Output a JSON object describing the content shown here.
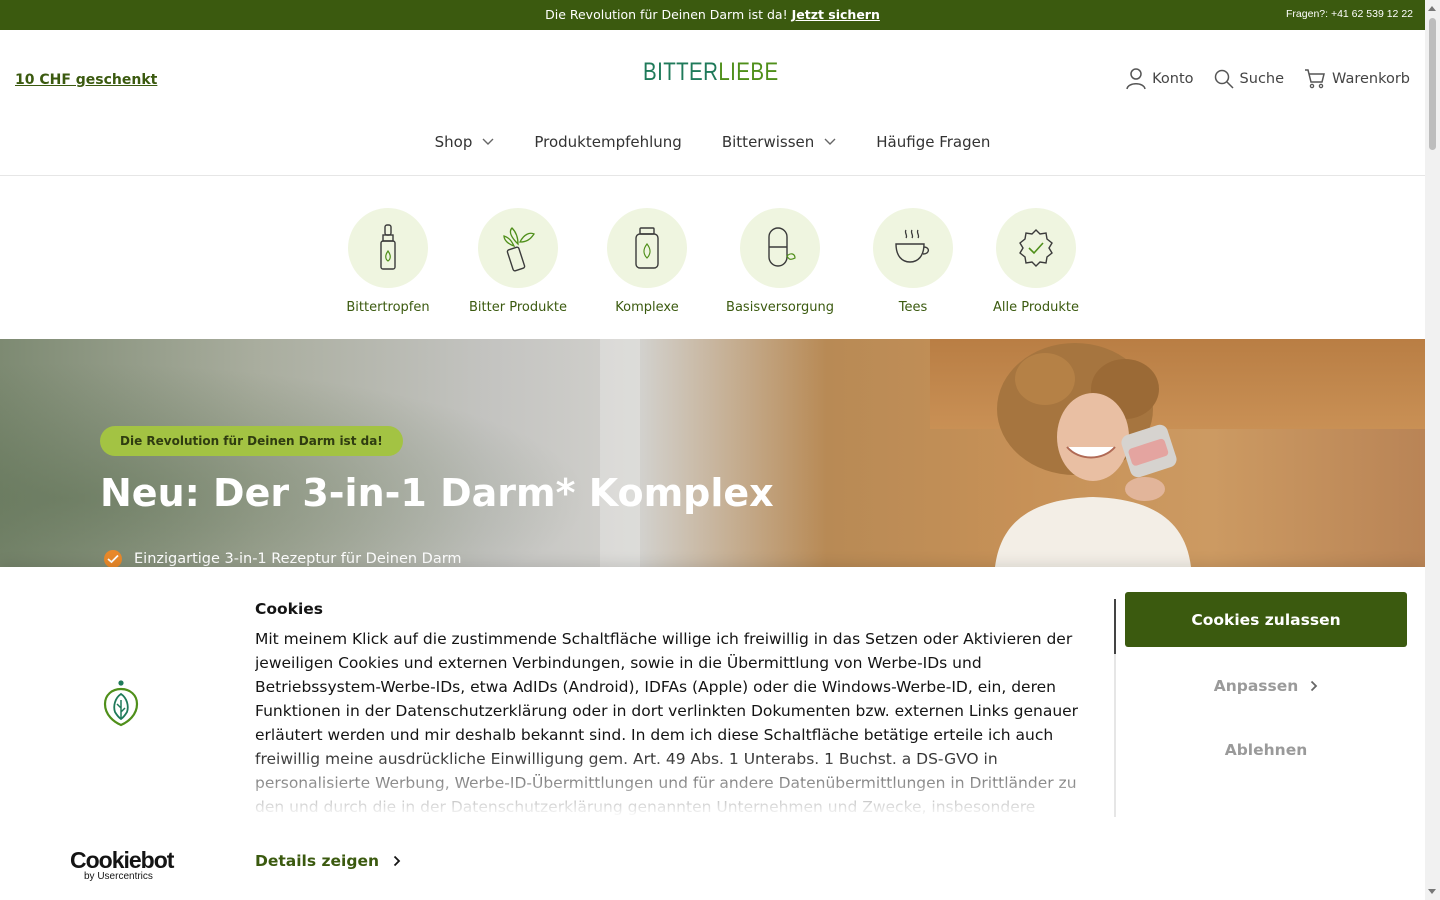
{
  "announcement": {
    "text": "Die Revolution für Deinen Darm ist da!",
    "link": "Jetzt sichern",
    "phone": "Fragen?: +41 62 539 12 22"
  },
  "header": {
    "gift_link": "10 CHF geschenkt",
    "logo": {
      "part1": "BITTER",
      "part2": "LIEBE"
    },
    "utils": {
      "account": "Konto",
      "search": "Suche",
      "cart": "Warenkorb"
    },
    "nav": [
      "Shop",
      "Produktempfehlung",
      "Bitterwissen",
      "Häufige Fragen"
    ]
  },
  "categories": [
    {
      "label": "Bittertropfen",
      "icon": "dropper-bottle-icon"
    },
    {
      "label": "Bitter Produkte",
      "icon": "herb-spray-icon"
    },
    {
      "label": "Komplexe",
      "icon": "supplement-jar-icon"
    },
    {
      "label": "Basisversorgung",
      "icon": "capsule-icon"
    },
    {
      "label": "Tees",
      "icon": "tea-cup-icon"
    },
    {
      "label": "Alle Produkte",
      "icon": "badge-check-icon"
    }
  ],
  "hero": {
    "badge": "Die Revolution für Deinen Darm ist da!",
    "title": "Neu: Der 3-in-1 Darm* Komplex",
    "bullet": "Einzigartige 3-in-1 Rezeptur für Deinen Darm"
  },
  "cookie": {
    "title": "Cookies",
    "body": "Mit meinem Klick auf die zustimmende Schaltfläche willige ich freiwillig in das Setzen oder Aktivieren der jeweiligen Cookies und externen Verbindungen, sowie in die Übermittlung von Werbe-IDs und Betriebssystem-Werbe-IDs, etwa AdIDs (Android), IDFAs (Apple) oder die Windows-Werbe-ID, ein, deren Funktionen in der Datenschutzerklärung oder in dort verlinkten Dokumenten bzw. externen Links genauer erläutert werden und mir deshalb bekannt sind. In dem ich diese Schaltfläche betätige erteile ich auch freiwillig meine ausdrückliche Einwilligung gem. Art. 49 Abs. 1 Unterabs. 1 Buchst. a DS-GVO in personalisierte Werbung, Werbe-ID-Übermittlungen und für andere Datenübermittlungen in Drittländer zu den und durch die in der Datenschutzerklärung genannten Unternehmen und Zwecke, insbesondere",
    "details": "Details zeigen",
    "allow": "Cookies zulassen",
    "customize": "Anpassen",
    "reject": "Ablehnen",
    "provider": "Cookiebot",
    "provider_sub": "by Usercentrics"
  },
  "colors": {
    "brand_green": "#3b5a0f",
    "badge_green": "#a3c343",
    "category_bg": "#eff5e0",
    "check_orange": "#e9892a"
  }
}
